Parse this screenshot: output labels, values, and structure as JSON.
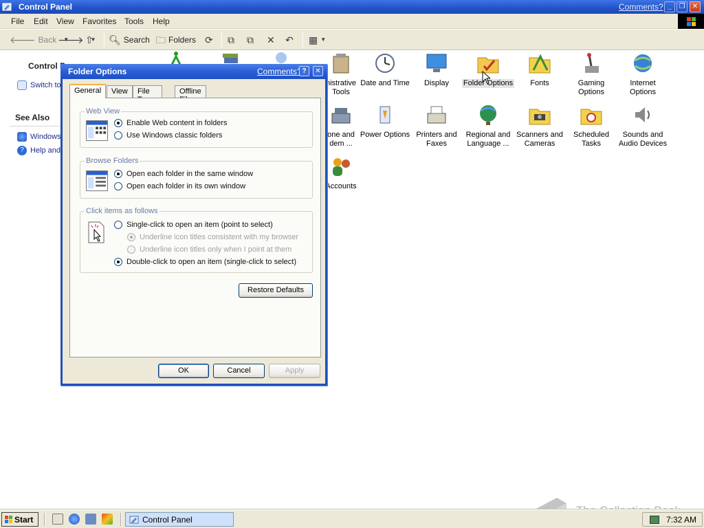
{
  "window": {
    "title": "Control Panel",
    "comments_link": "Comments?",
    "caption_buttons": [
      "minimize",
      "restore",
      "close"
    ]
  },
  "menubar": [
    "File",
    "Edit",
    "View",
    "Favorites",
    "Tools",
    "Help"
  ],
  "toolbar": {
    "back": "Back",
    "search": "Search",
    "folders": "Folders"
  },
  "left_pane": {
    "control_panel_heading": "Control P",
    "switch_link": "Switch to",
    "see_also_heading": "See Also",
    "links": [
      "Windows",
      "Help and"
    ]
  },
  "control_panel_items": [
    {
      "label": "nistrative\nTools",
      "icon": "administrative-tools-icon"
    },
    {
      "label": "Date and Time",
      "icon": "date-time-icon"
    },
    {
      "label": "Display",
      "icon": "display-icon"
    },
    {
      "label": "Folder Options",
      "icon": "folder-options-icon",
      "selected": true
    },
    {
      "label": "Fonts",
      "icon": "fonts-icon"
    },
    {
      "label": "Gaming\nOptions",
      "icon": "gaming-options-icon"
    },
    {
      "label": "Internet\nOptions",
      "icon": "internet-options-icon"
    },
    {
      "label": "one and\ndem ...",
      "icon": "phone-modem-icon"
    },
    {
      "label": "Power Options",
      "icon": "power-options-icon"
    },
    {
      "label": "Printers and\nFaxes",
      "icon": "printers-faxes-icon"
    },
    {
      "label": "Regional and\nLanguage ...",
      "icon": "regional-language-icon"
    },
    {
      "label": "Scanners and\nCameras",
      "icon": "scanners-cameras-icon"
    },
    {
      "label": "Scheduled\nTasks",
      "icon": "scheduled-tasks-icon"
    },
    {
      "label": "Sounds and\nAudio Devices",
      "icon": "sounds-audio-icon"
    },
    {
      "label": "Accounts",
      "icon": "user-accounts-icon"
    }
  ],
  "dialog": {
    "title": "Folder Options",
    "comments_link": "Comments?",
    "tabs": [
      "General",
      "View",
      "File Types",
      "Offline Files"
    ],
    "active_tab": "General",
    "web_view": {
      "title": "Web View",
      "options": [
        {
          "label": "Enable Web content in folders",
          "checked": true
        },
        {
          "label": "Use Windows classic folders",
          "checked": false
        }
      ]
    },
    "browse_folders": {
      "title": "Browse Folders",
      "options": [
        {
          "label": "Open each folder in the same window",
          "checked": true
        },
        {
          "label": "Open each folder in its own window",
          "checked": false
        }
      ]
    },
    "click_items": {
      "title": "Click items as follows",
      "single_click": "Single-click to open an item (point to select)",
      "underline_browser": "Underline icon titles consistent with my browser",
      "underline_point": "Underline icon titles only when I point at them",
      "double_click": "Double-click to open an item (single-click to select)",
      "selected": "double_click"
    },
    "restore_defaults": "Restore Defaults",
    "buttons": {
      "ok": "OK",
      "cancel": "Cancel",
      "apply": "Apply"
    }
  },
  "taskbar": {
    "start": "Start",
    "task": "Control Panel",
    "clock": "7:32 AM"
  },
  "watermark": "The Collection Book",
  "colors": {
    "xp_title_blue": "#2255c9",
    "window_face": "#ece9d8",
    "link_blue": "#1a2f8a"
  }
}
